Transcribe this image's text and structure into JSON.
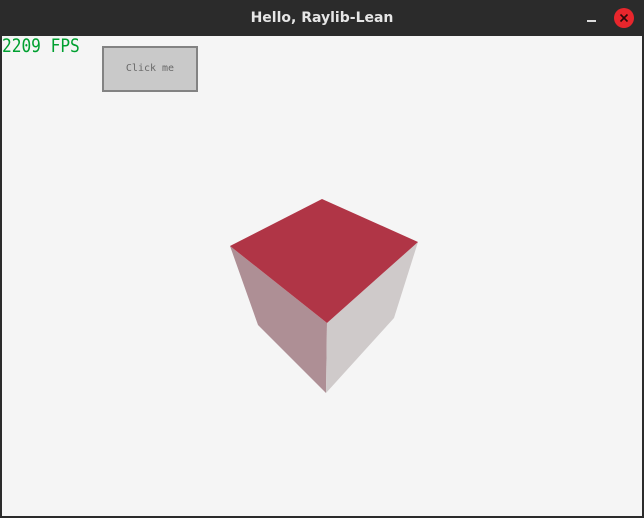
{
  "window": {
    "title": "Hello, Raylib-Lean"
  },
  "titlebar": {
    "minimize_icon": "minimize-icon",
    "close_icon": "close-icon",
    "close_color": "#e8262c"
  },
  "canvas": {
    "background": "#f5f5f5",
    "fps_text": "2209 FPS",
    "fps_color": "#00a030",
    "button_label": "Click me"
  },
  "cube": {
    "top_face_color": "#b03546",
    "left_face_color": "#ae8f95",
    "right_face_color": "#cfcaca"
  }
}
